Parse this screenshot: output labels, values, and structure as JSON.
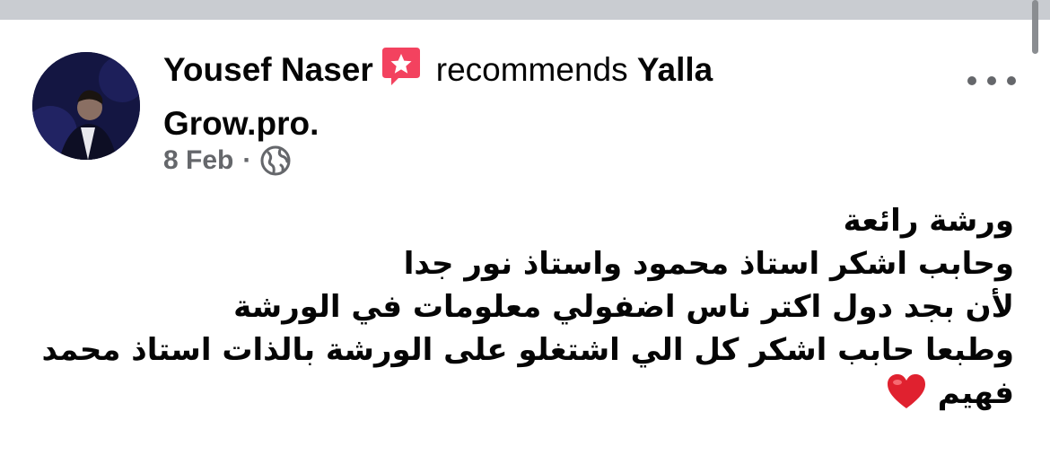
{
  "post": {
    "author": "Yousef Naser",
    "recommend_text": "recommends",
    "page_name": "Yalla Grow.pro.",
    "date": "8 Feb",
    "separator": "·",
    "icons": {
      "badge": "recommendation-badge-icon",
      "audience": "globe-icon",
      "more": "more-options-icon",
      "heart": "red-heart-icon"
    },
    "body_lines": [
      "ورشة رائعة",
      "وحابب اشكر استاذ محمود واستاذ نور جدا",
      "لأن بجد دول اكتر ناس اضفولي معلومات في الورشة",
      "وطبعا حابب اشكر كل الي اشتغلو على الورشة بالذات استاذ محمد",
      "فهيم"
    ],
    "colors": {
      "text": "#050505",
      "secondary": "#65676b",
      "badge": "#f3425f",
      "heart": "#e0212f"
    }
  }
}
